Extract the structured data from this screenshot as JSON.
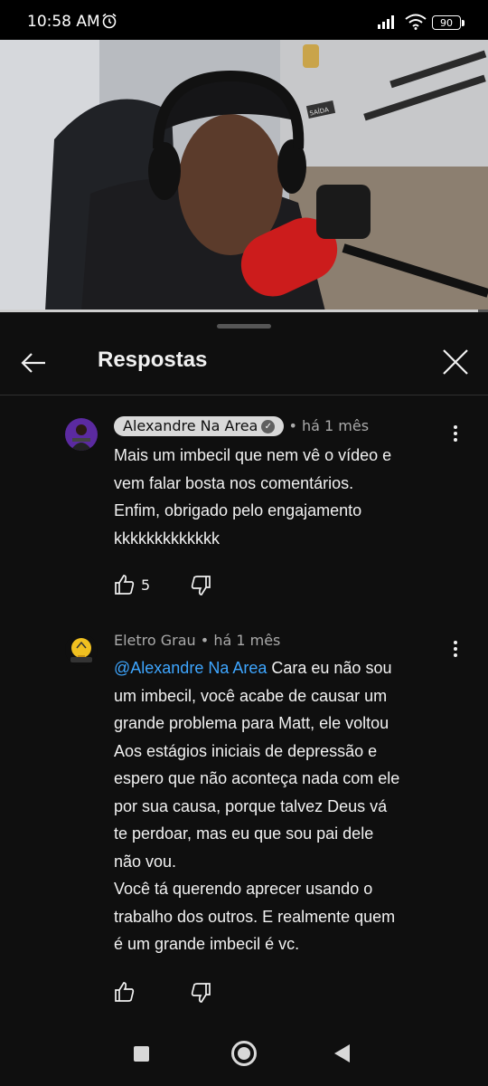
{
  "status_bar": {
    "time": "10:58 AM",
    "battery": "90"
  },
  "video": {
    "progress_fraction": 0.98,
    "sign_text": "SAÍDA"
  },
  "panel": {
    "title": "Respostas"
  },
  "comments": [
    {
      "author": "Alexandre Na Area",
      "time": "• há 1 mês",
      "text": "Mais um imbecil que nem vê o vídeo e\nvem falar bosta nos comentários.\nEnfim, obrigado pelo engajamento\nkkkkkkkkkkkkk",
      "likes": "5"
    },
    {
      "author": "Eletro Grau",
      "time": "• há 1 mês",
      "mention": "@Alexandre Na Area",
      "text": "  Cara eu não sou\num imbecil, você acabe de causar um\ngrande problema para Matt, ele voltou\nAos estágios iniciais de depressão e\nespero que não aconteça nada com ele\npor sua causa, porque talvez Deus vá\nte perdoar, mas eu que sou pai dele\nnão vou.\nVocê tá querendo aprecer usando o\ntrabalho dos outros. E realmente quem\né um grande imbecil é vc."
    }
  ]
}
